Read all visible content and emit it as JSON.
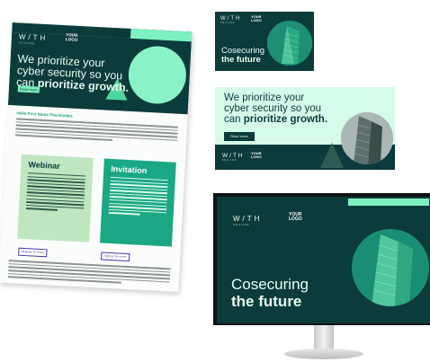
{
  "brand": {
    "logo_wordmark": "W/TH",
    "logo_sub": "SECURE",
    "your_logo": "YOUR\nLOGO",
    "colors": {
      "dark": "#0b3b3a",
      "mint": "#7ff0c0",
      "green": "#1aa784",
      "light_mint": "#d6fbe9",
      "sage": "#bfe6c0"
    }
  },
  "flyer": {
    "headline_line1": "We prioritize your",
    "headline_line2": "cyber security so you",
    "headline_line3": "can ",
    "headline_bold": "prioritize growth.",
    "cta": "Read more",
    "greeting": "Hello First Name Placeholder,",
    "webinar_title": "Webinar",
    "invitation_title": "Invitation",
    "register_link": "Register for event",
    "learn_link": "Sign up for event"
  },
  "small_banner": {
    "headline_line1": "Cosecuring",
    "headline_line2": "the future"
  },
  "wide_banner": {
    "headline_line1": "We prioritize your",
    "headline_line2": "cyber security so you",
    "headline_line3": "can ",
    "headline_bold": "prioritize growth.",
    "cta": "Read more"
  },
  "monitor": {
    "headline_line1": "Cosecuring",
    "headline_line2": "the future"
  }
}
